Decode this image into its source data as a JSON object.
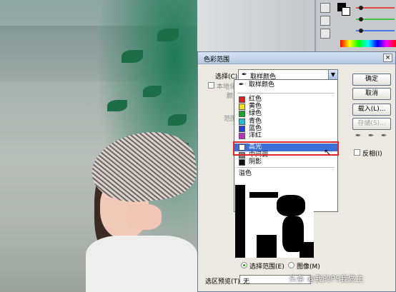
{
  "dialog": {
    "title": "色彩范围",
    "close": "×",
    "select_label": "选择(C):",
    "select_value": "取样颜色",
    "localized_label": "本地化颜",
    "color_label": "颜色",
    "range_label": "范围"
  },
  "dropdown": {
    "items": [
      {
        "label": "取样颜色",
        "color": ""
      },
      {
        "label": "红色",
        "color": "#e02020"
      },
      {
        "label": "黄色",
        "color": "#f0e020"
      },
      {
        "label": "绿色",
        "color": "#20a030"
      },
      {
        "label": "青色",
        "color": "#20c0d0"
      },
      {
        "label": "蓝色",
        "color": "#2040d0"
      },
      {
        "label": "洋红",
        "color": "#c030c0"
      },
      {
        "label": "高光",
        "color": "#ffffff"
      },
      {
        "label": "中间调",
        "color": "#808080"
      },
      {
        "label": "阴影",
        "color": "#101010"
      },
      {
        "label": "溢色",
        "color": ""
      }
    ]
  },
  "buttons": {
    "ok": "确定",
    "cancel": "取消",
    "load": "载入(L)...",
    "save": "存储(S)..."
  },
  "invert_label": "反相(I)",
  "radio": {
    "selection": "选择范围(E)",
    "image": "图像(M)"
  },
  "selection_preview": {
    "label": "选区预览(T):",
    "value": "无"
  },
  "watermark": "头条 @我的PS我做主",
  "colors": {
    "dialog_bg": "#ebe9e1",
    "highlight_border": "#e0262b",
    "selected_item": "#3d6fd8"
  }
}
